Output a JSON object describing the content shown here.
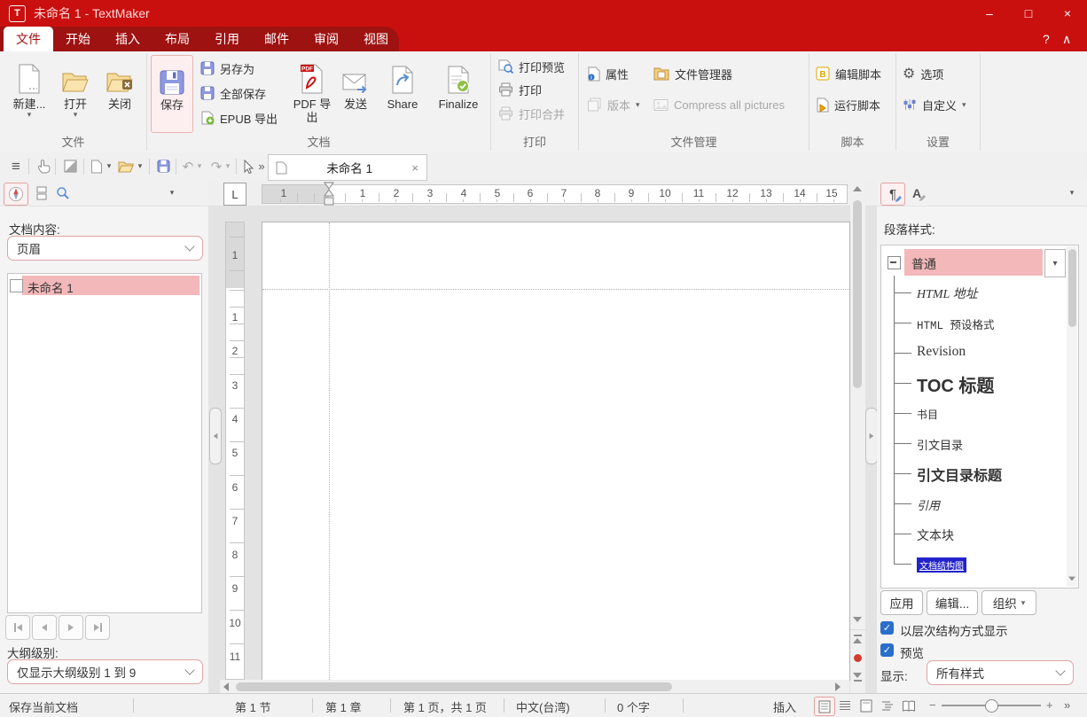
{
  "colors": {
    "red": "#c9100f",
    "dark-red": "#9e1211",
    "pink": "#f3b8ba",
    "pink-bd": "#dfa3a4",
    "blue": "#2a6fc9",
    "rib": "#f2f2f2",
    "panel": "#f5f4f4",
    "doc": "#e3e3e3",
    "selblue": "#2222cc"
  },
  "window": {
    "title": "未命名 1 - TextMaker"
  },
  "icons": {
    "app": "T",
    "min": "–",
    "max": "□",
    "close": "×",
    "help": "?",
    "collapse": "∧",
    "hamburger": "≡",
    "undo": "↶",
    "redo": "↷",
    "dropdown": "▾",
    "overflow": "»",
    "tab_close": "×",
    "gear": "⚙",
    "L": "L",
    "B": "B",
    "para": "¶",
    "char": "A",
    "check": "✓",
    "up": "▲",
    "down": "▼",
    "minus": "−",
    "plus": "+"
  },
  "menubar": {
    "tabs": [
      "文件",
      "开始",
      "插入",
      "布局",
      "引用",
      "邮件",
      "审阅",
      "视图"
    ]
  },
  "ribbon": {
    "file": {
      "label": "文件",
      "new": "新建...",
      "open": "打开",
      "close": "关闭"
    },
    "doc": {
      "label": "文档",
      "save": "保存",
      "save_as": "另存为",
      "save_all": "全部保存",
      "epub": "EPUB 导出",
      "pdf": "PDF 导出",
      "send": "发送",
      "share": "Share",
      "finalize": "Finalize"
    },
    "print": {
      "label": "打印",
      "preview": "打印预览",
      "print": "打印",
      "merge": "打印合并"
    },
    "mgmt": {
      "label": "文件管理",
      "props": "属性",
      "manager": "文件管理器",
      "versions": "版本",
      "compress": "Compress all pictures"
    },
    "script": {
      "label": "脚本",
      "edit": "编辑脚本",
      "run": "运行脚本"
    },
    "settings": {
      "label": "设置",
      "options": "选项",
      "customize": "自定义"
    }
  },
  "quickbar": {
    "tab": "未命名 1"
  },
  "left_panel": {
    "content_label": "文档内容:",
    "content_value": "页眉",
    "doc_item": "未命名 1",
    "outline_label": "大纲级别:",
    "outline_value": "仅显示大纲级别 1 到 9"
  },
  "ruler": {
    "h_margin": "1",
    "h": [
      "1",
      "2",
      "3",
      "4",
      "5",
      "6",
      "7",
      "8",
      "9",
      "10",
      "11",
      "12",
      "13",
      "14",
      "15"
    ],
    "v_margin": "1",
    "v": [
      "1",
      "2",
      "3",
      "4",
      "5",
      "6",
      "7",
      "8",
      "9",
      "10",
      "11"
    ]
  },
  "right_panel": {
    "label": "段落样式:",
    "styles": [
      "普通",
      "HTML 地址",
      "HTML 预设格式",
      "Revision",
      "TOC 标题",
      "书目",
      "引文目录",
      "引文目录标题",
      "引用",
      "文本块",
      "文档结构图"
    ],
    "apply": "应用",
    "edit": "编辑...",
    "organize": "组织",
    "hierarchy": "以层次结构方式显示",
    "preview": "预览",
    "show_label": "显示:",
    "show_value": "所有样式"
  },
  "statusbar": {
    "hint": "保存当前文档",
    "section": "第 1 节",
    "chapter": "第 1 章",
    "page": "第 1 页，共 1 页",
    "lang": "中文(台湾)",
    "words": "0 个字",
    "insert": "插入"
  }
}
